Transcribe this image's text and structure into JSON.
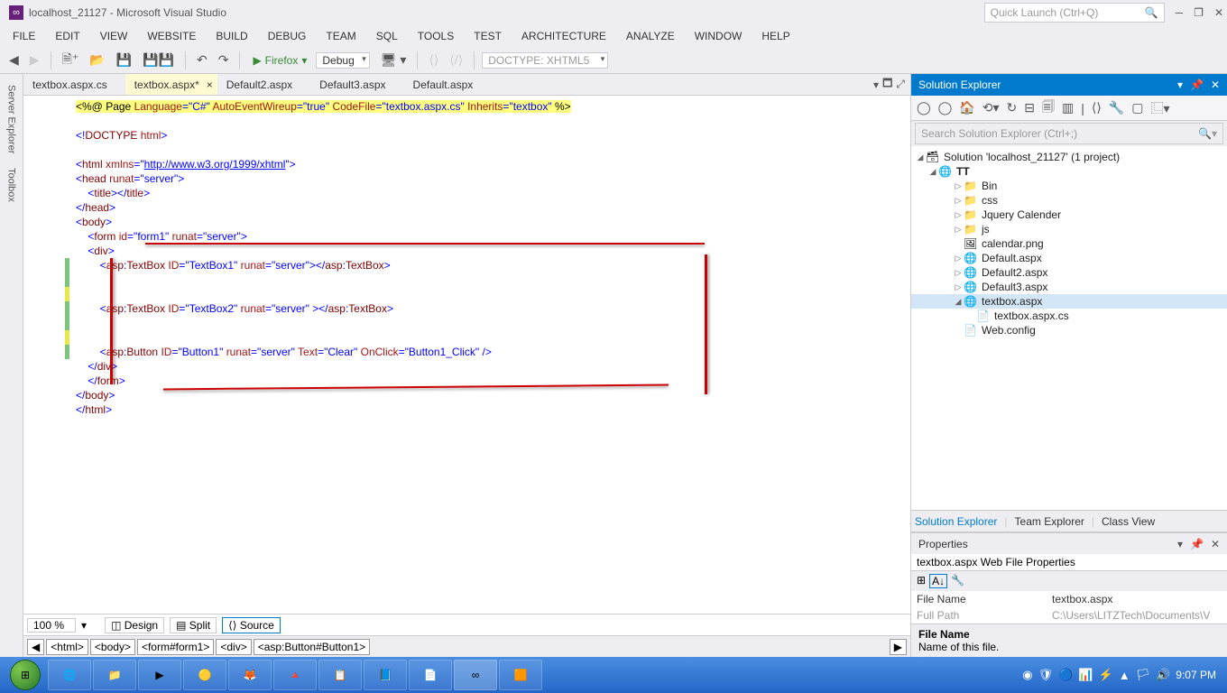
{
  "window": {
    "title": "localhost_21127 - Microsoft Visual Studio",
    "quicklaunch_placeholder": "Quick Launch (Ctrl+Q)"
  },
  "menu": [
    "FILE",
    "EDIT",
    "VIEW",
    "WEBSITE",
    "BUILD",
    "DEBUG",
    "TEAM",
    "SQL",
    "TOOLS",
    "TEST",
    "ARCHITECTURE",
    "ANALYZE",
    "WINDOW",
    "HELP"
  ],
  "toolbar": {
    "run_label": "Firefox",
    "config": "Debug",
    "doctype": "DOCTYPE: XHTML5"
  },
  "left_tabs": [
    "Server Explorer",
    "Toolbox"
  ],
  "tabs": [
    {
      "label": "textbox.aspx.cs",
      "active": false
    },
    {
      "label": "textbox.aspx*",
      "active": true
    },
    {
      "label": "Default2.aspx",
      "active": false
    },
    {
      "label": "Default3.aspx",
      "active": false
    },
    {
      "label": "Default.aspx",
      "active": false
    }
  ],
  "code_bottom": {
    "zoom": "100 %",
    "views": [
      "Design",
      "Split",
      "Source"
    ],
    "selected_view": "Source"
  },
  "breadcrumb": [
    "<html>",
    "<body>",
    "<form#form1>",
    "<div>",
    "<asp:Button#Button1>"
  ],
  "solution_explorer": {
    "title": "Solution Explorer",
    "search_placeholder": "Search Solution Explorer (Ctrl+;)",
    "root": "Solution 'localhost_21127' (1 project)",
    "project": "TT",
    "items": [
      {
        "icon": "📁",
        "label": "Bin",
        "indent": 2,
        "arrow": "▷"
      },
      {
        "icon": "📁",
        "label": "css",
        "indent": 2,
        "arrow": "▷"
      },
      {
        "icon": "📁",
        "label": "Jquery Calender",
        "indent": 2,
        "arrow": "▷"
      },
      {
        "icon": "📁",
        "label": "js",
        "indent": 2,
        "arrow": "▷"
      },
      {
        "icon": "🖼",
        "label": "calendar.png",
        "indent": 2,
        "arrow": ""
      },
      {
        "icon": "🌐",
        "label": "Default.aspx",
        "indent": 2,
        "arrow": "▷"
      },
      {
        "icon": "🌐",
        "label": "Default2.aspx",
        "indent": 2,
        "arrow": "▷"
      },
      {
        "icon": "🌐",
        "label": "Default3.aspx",
        "indent": 2,
        "arrow": "▷"
      },
      {
        "icon": "🌐",
        "label": "textbox.aspx",
        "indent": 2,
        "arrow": "◢",
        "sel": true
      },
      {
        "icon": "📄",
        "label": "textbox.aspx.cs",
        "indent": 3,
        "arrow": ""
      },
      {
        "icon": "📄",
        "label": "Web.config",
        "indent": 2,
        "arrow": ""
      }
    ],
    "tabs": [
      "Solution Explorer",
      "Team Explorer",
      "Class View"
    ]
  },
  "properties": {
    "title": "Properties",
    "subtitle": "textbox.aspx Web File Properties",
    "rows": [
      {
        "k": "File Name",
        "v": "textbox.aspx"
      },
      {
        "k": "Full Path",
        "v": "C:\\Users\\LITZTech\\Documents\\V"
      }
    ],
    "desc_title": "File Name",
    "desc_body": "Name of this file."
  },
  "taskbar": {
    "time": "9:07 PM"
  }
}
